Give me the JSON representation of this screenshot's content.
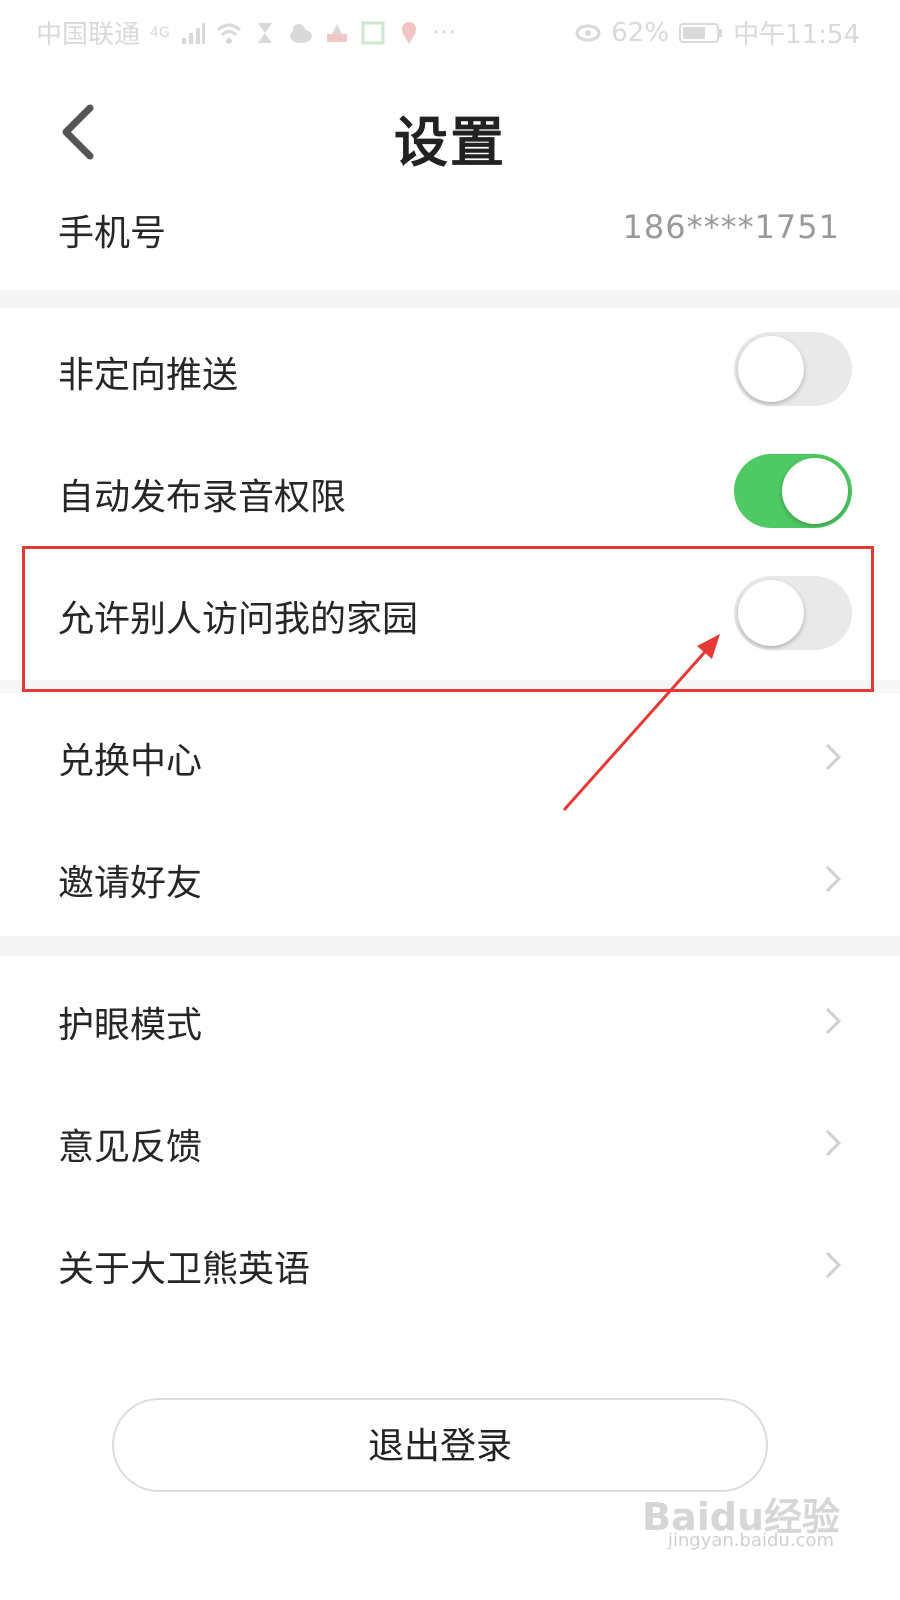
{
  "status_bar": {
    "carrier": "中国联通",
    "network": "4G",
    "battery": "62%",
    "time": "中午11:54"
  },
  "header": {
    "title": "设置"
  },
  "rows": {
    "phone": {
      "label": "手机号",
      "value": "186****1751"
    },
    "non_targeted_push": {
      "label": "非定向推送",
      "toggle_on": false
    },
    "auto_publish_recording": {
      "label": "自动发布录音权限",
      "toggle_on": true
    },
    "allow_visit_home": {
      "label": "允许别人访问我的家园",
      "toggle_on": false
    },
    "exchange_center": {
      "label": "兑换中心"
    },
    "invite_friends": {
      "label": "邀请好友"
    },
    "eye_mode": {
      "label": "护眼模式"
    },
    "feedback": {
      "label": "意见反馈"
    },
    "about": {
      "label": "关于大卫熊英语"
    }
  },
  "logout": {
    "label": "退出登录"
  },
  "watermark": {
    "brand": "Baidu经验",
    "url": "jingyan.baidu.com"
  },
  "colors": {
    "toggle_on": "#4ec963",
    "toggle_off": "#e9e9e9",
    "annotation": "#e53935"
  }
}
